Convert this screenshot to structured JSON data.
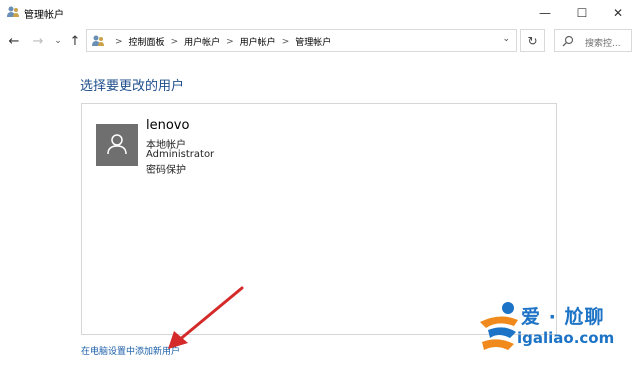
{
  "window": {
    "title": "管理帐户",
    "min_glyph": "—",
    "max_glyph": "☐",
    "close_glyph": "✕"
  },
  "nav": {
    "back_glyph": "←",
    "forward_glyph": "→",
    "recent_glyph": "⌄",
    "up_glyph": "↑",
    "breadcrumbs": [
      "控制面板",
      "用户帐户",
      "用户帐户",
      "管理帐户"
    ],
    "sep_glyph": ">",
    "dropdown_glyph": "⌄",
    "refresh_glyph": "↻",
    "search_placeholder": "搜索控..."
  },
  "main": {
    "heading": "选择要更改的用户",
    "user": {
      "name": "lenovo",
      "type": "本地帐户",
      "role": "Administrator",
      "protection": "密码保护"
    },
    "add_user_link": "在电脑设置中添加新用户"
  },
  "watermark": {
    "brand": "爱 · 尬聊",
    "url": "igaliao.com"
  },
  "colors": {
    "heading": "#1e4e8c",
    "link": "#1a5ea8",
    "avatar_bg": "#6f6f6f",
    "arrow": "#d42a2a",
    "watermark_blue": "#1d73c5",
    "watermark_orange": "#f08a1c"
  }
}
